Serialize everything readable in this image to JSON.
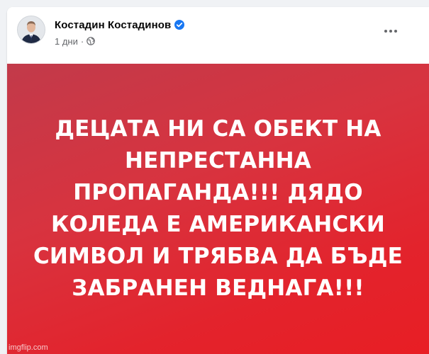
{
  "post": {
    "author": {
      "name": "Костадин Костадинов",
      "verified": true
    },
    "timestamp": "1 дни",
    "separator": "·",
    "audience_icon": "globe-icon",
    "more_icon": "more-horizontal-icon",
    "image": {
      "text_lines": [
        "ДЕЦАТА НИ СА ОБЕКТ НА",
        "НЕПРЕСТАННА",
        "ПРОПАГАНДА!!! ДЯДО",
        "КОЛЕДА Е АМЕРИКАНСКИ",
        "СИМВОЛ И ТРЯБВА ДА БЪДЕ",
        "ЗАБРАНЕН ВЕДНАГА!!!"
      ],
      "watermark": "imgflip.com",
      "background_colors": [
        "#c23a4a",
        "#e81e24"
      ]
    }
  },
  "colors": {
    "verified_badge": "#1877f2",
    "meta_text": "#65676b",
    "name_text": "#050505"
  }
}
